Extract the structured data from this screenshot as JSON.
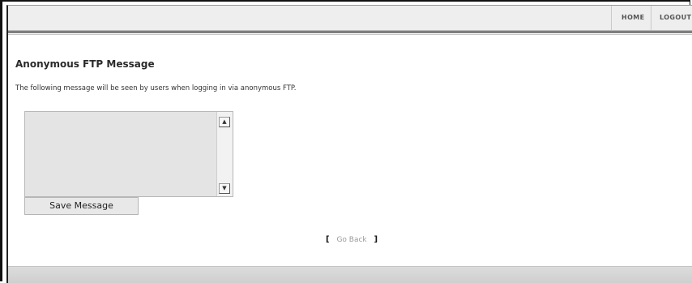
{
  "nav": {
    "items": [
      {
        "label": "HOME"
      },
      {
        "label": "LOGOUT"
      }
    ]
  },
  "page": {
    "title": "Anonymous FTP Message",
    "description": "The following message will be seen by users when logging in via anonymous FTP."
  },
  "form": {
    "message_value": "",
    "save_label": "Save Message"
  },
  "footer": {
    "go_back_label": "Go Back",
    "bracket_left": "[",
    "bracket_right": "]"
  }
}
